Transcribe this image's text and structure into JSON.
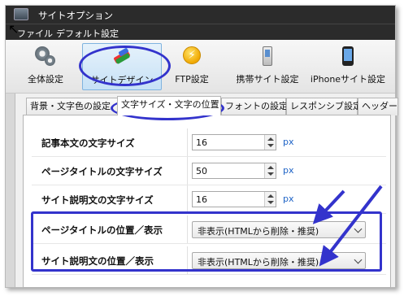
{
  "window": {
    "title": "サイトオプション"
  },
  "menubar": {
    "file": "ファイル",
    "default_settings": "デフォルト設定"
  },
  "toolbar": {
    "general": "全体設定",
    "site_design": "サイトデザイン",
    "ftp": "FTP設定",
    "mobile": "携帯サイト設定",
    "iphone": "iPhoneサイト設定"
  },
  "tabs": [
    {
      "label": "背景・文字色の設定"
    },
    {
      "label": "文字サイズ・文字の位置"
    },
    {
      "label": "フォントの設定"
    },
    {
      "label": "レスポンシブ設定"
    },
    {
      "label": "ヘッダー"
    }
  ],
  "rows": {
    "body_font_size": {
      "label": "記事本文の文字サイズ",
      "value": "16",
      "unit": "px"
    },
    "page_title_size": {
      "label": "ページタイトルの文字サイズ",
      "value": "50",
      "unit": "px"
    },
    "site_desc_size": {
      "label": "サイト説明文の文字サイズ",
      "value": "16",
      "unit": "px"
    },
    "page_title_position": {
      "label": "ページタイトルの位置／表示",
      "value": "非表示(HTMLから削除・推奨)"
    },
    "site_desc_position": {
      "label": "サイト説明文の位置／表示",
      "value": "非表示(HTMLから削除・推奨)"
    }
  },
  "colors": {
    "annotation": "#3333cc",
    "titlebar": "#2b2b2b",
    "unit_link": "#1e63c6"
  },
  "icons": [
    "gear-icon",
    "design-palette-icon",
    "ftp-bolt-icon",
    "mobile-phone-icon",
    "iphone-icon",
    "cursor-icon"
  ]
}
